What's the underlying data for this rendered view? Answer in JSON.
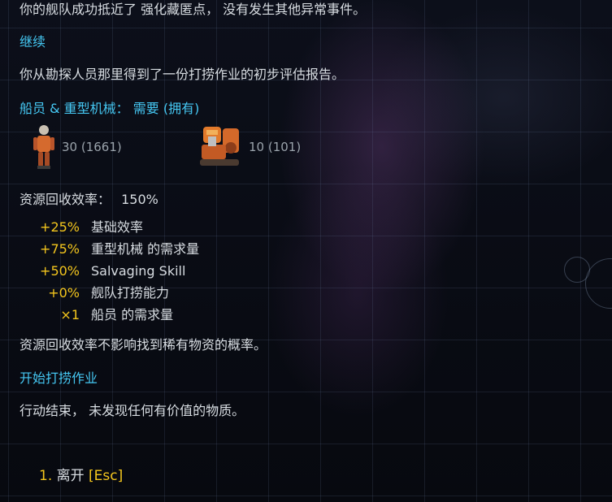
{
  "text": {
    "line1": "你的舰队成功抵近了 强化藏匿点， 没有发生其他异常事件。",
    "continue": "继续",
    "line2": "你从勘探人员那里得到了一份打捞作业的初步评估报告。",
    "requirements_header": "船员 & 重型机械： 需要 (拥有)",
    "crew_count": "30 (1661)",
    "machinery_count": "10 (101)",
    "efficiency_label": "资源回收效率：",
    "efficiency_value": "150%",
    "note": "资源回收效率不影响找到稀有物资的概率。",
    "start_salvage": "开始打捞作业",
    "result": "行动结束， 未发现任何有价值的物质。"
  },
  "modifiers": [
    {
      "value": "+25%",
      "label": "基础效率"
    },
    {
      "value": "+75%",
      "label": "重型机械 的需求量"
    },
    {
      "value": "+50%",
      "label": "Salvaging Skill"
    },
    {
      "value": "+0%",
      "label": "舰队打捞能力"
    },
    {
      "value": "×1",
      "label": "船员 的需求量"
    }
  ],
  "options": [
    {
      "number": "1.",
      "label": "离开",
      "hotkey": "[Esc]"
    }
  ],
  "colors": {
    "highlight": "#45c7f2",
    "value": "#f4c61d",
    "text": "#d8dde2"
  },
  "icons": {
    "crew": "crew-member-icon",
    "machinery": "heavy-machinery-icon"
  }
}
